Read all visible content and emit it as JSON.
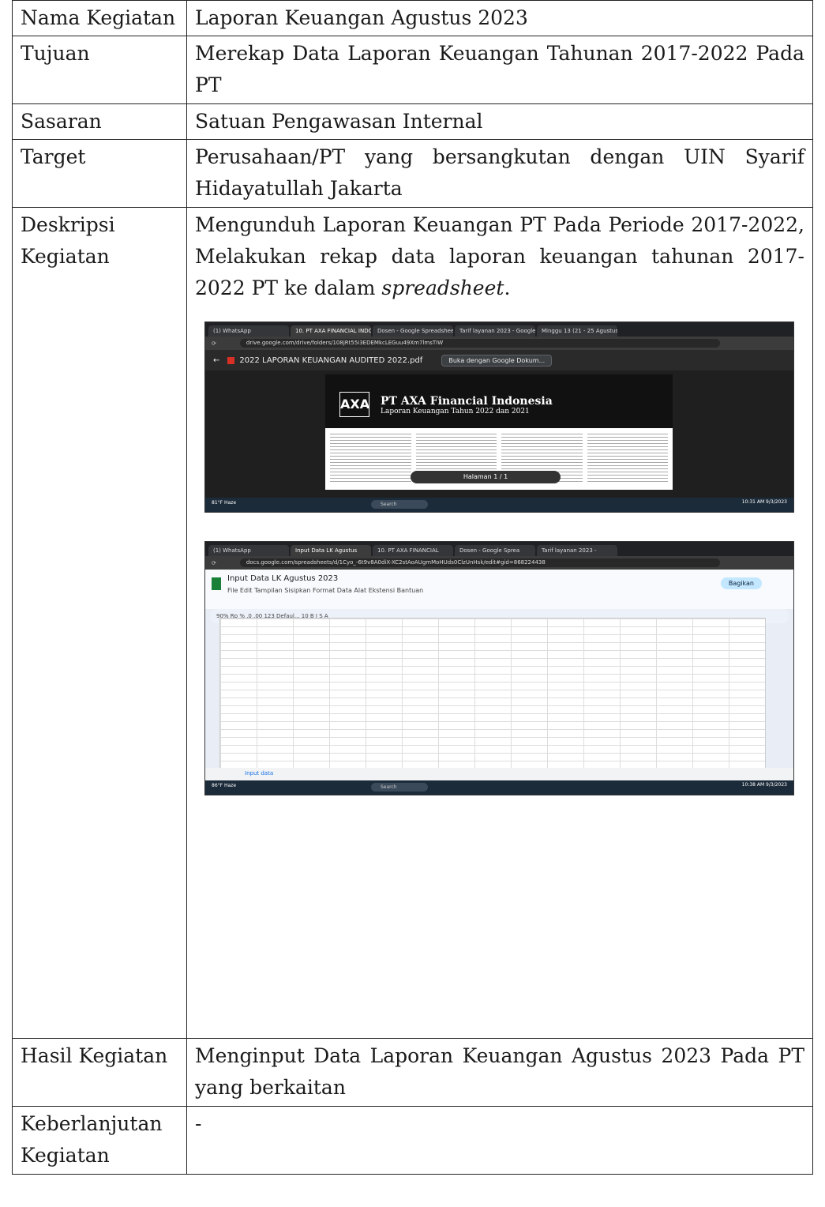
{
  "rows": {
    "nama": {
      "label": "Nama Kegiatan",
      "value": "Laporan Keuangan Agustus 2023"
    },
    "tujuan": {
      "label": "Tujuan",
      "value": "Merekap Data Laporan Keuangan Tahunan 2017-2022 Pada PT"
    },
    "sasaran": {
      "label": "Sasaran",
      "value": "Satuan Pengawasan Internal"
    },
    "target": {
      "label": "Target",
      "value": "Perusahaan/PT yang bersangkutan dengan UIN Syarif Hidayatullah Jakarta"
    },
    "deskripsi": {
      "label": "Deskripsi Kegiatan",
      "value_main": "Mengunduh Laporan Keuangan PT Pada Periode 2017-2022, Melakukan rekap data laporan keuangan tahunan 2017-2022 PT ke dalam ",
      "value_italic": "spreadsheet",
      "value_end": "."
    },
    "hasil": {
      "label": "Hasil Kegiatan",
      "value": "Menginput Data Laporan Keuangan Agustus 2023 Pada PT yang berkaitan"
    },
    "keberlanjutan": {
      "label": "Keberlanjutan Kegiatan",
      "value": "-"
    }
  },
  "screenshot1": {
    "tabs": [
      "(1) WhatsApp",
      "10. PT AXA FINANCIAL INDO",
      "Dosen - Google Spreadsheet",
      "Tarif layanan 2023 - Google",
      "Minggu 13 (21 - 25 Agustus"
    ],
    "url": "drive.google.com/drive/folders/108jRt55i3EDEMkcLEGuu49Xm7lmsTIW",
    "pdf_name": "2022 LAPORAN KEUANGAN AUDITED 2022.pdf",
    "open_with": "Buka dengan Google Dokum...",
    "axa_logo": "AXA",
    "pdf_title": "PT AXA Financial Indonesia",
    "pdf_subtitle": "Laporan Keuangan Tahun 2022 dan 2021",
    "pager": "Halaman  1  /  1",
    "weather": "81°F Haze",
    "search": "Search",
    "clock": "10:31 AM 9/3/2023"
  },
  "screenshot2": {
    "tabs": [
      "(1) WhatsApp",
      "Input Data LK Agustus",
      "10. PT AXA FINANCIAL",
      "Dosen - Google Sprea",
      "Tarif layanan 2023 -"
    ],
    "url": "docs.google.com/spreadsheets/d/1Cyo_-6t9v8A0diX-XC2stAoAUgmMoHUds0ClzUnHsk/edit#gid=868224438",
    "doc_title": "Input Data LK Agustus 2023",
    "menu": "File  Edit  Tampilan  Sisipkan  Format  Data  Alat  Ekstensi  Bantuan",
    "toolbar": "90%   Rp   %   .0   .00   123   Defaul...   10   B  I  S  A",
    "share": "Bagikan",
    "sheet_tab": "Input data",
    "weather": "86°F Haze",
    "search": "Search",
    "clock": "10:38 AM 9/3/2023"
  }
}
